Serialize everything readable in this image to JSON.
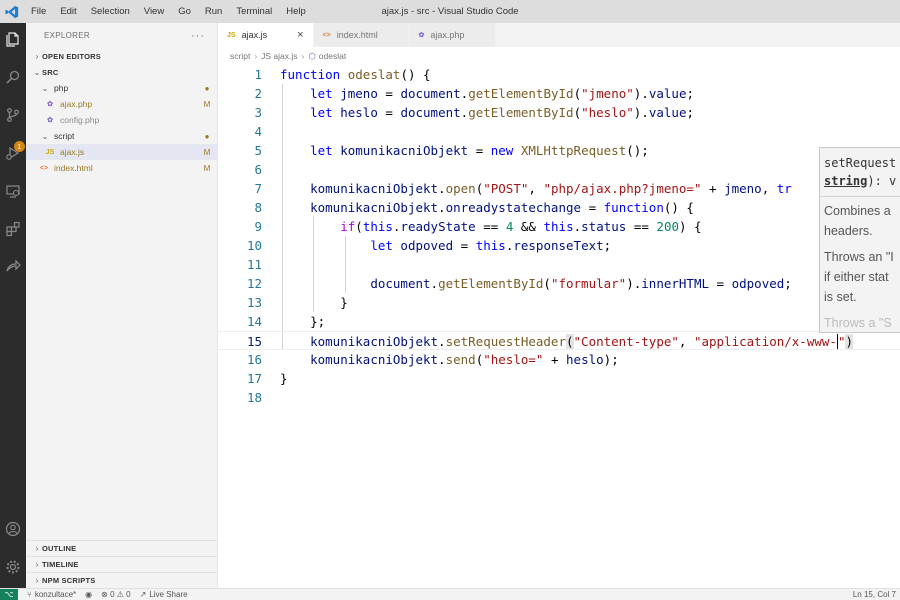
{
  "window": {
    "title": "ajax.js - src - Visual Studio Code",
    "menu": [
      "File",
      "Edit",
      "Selection",
      "View",
      "Go",
      "Run",
      "Terminal",
      "Help"
    ]
  },
  "activity": [
    "files-icon",
    "search-icon",
    "source-control-icon",
    "run-debug-icon",
    "remote-explorer-icon",
    "extensions-icon",
    "live-share-icon",
    "account-icon",
    "settings-gear-icon"
  ],
  "activity_badge": "1",
  "sidebar": {
    "header": "EXPLORER",
    "header_more": "···",
    "open_editors": "OPEN EDITORS",
    "root": "SRC",
    "tree": [
      {
        "label": "php",
        "kind": "folder",
        "status": "●"
      },
      {
        "label": "ajax.php",
        "kind": "php",
        "status": "M"
      },
      {
        "label": "config.php",
        "kind": "php",
        "status": ""
      },
      {
        "label": "script",
        "kind": "folder",
        "status": "●"
      },
      {
        "label": "ajax.js",
        "kind": "js",
        "status": "M"
      },
      {
        "label": "index.html",
        "kind": "html",
        "status": "M"
      }
    ],
    "bottom": [
      "OUTLINE",
      "TIMELINE",
      "NPM SCRIPTS"
    ]
  },
  "tabs": [
    {
      "label": "ajax.js",
      "icon": "JS",
      "active": true
    },
    {
      "label": "index.html",
      "icon": "<>",
      "active": false
    },
    {
      "label": "ajax.php",
      "icon": "php",
      "active": false
    }
  ],
  "tab_close": "×",
  "breadcrumb": [
    "script",
    "JS ajax.js",
    "odeslat"
  ],
  "editor": {
    "line_numbers": [
      "1",
      "2",
      "3",
      "4",
      "5",
      "6",
      "7",
      "8",
      "9",
      "10",
      "11",
      "12",
      "13",
      "14",
      "15",
      "16",
      "17",
      "18"
    ],
    "current_line": 15
  },
  "hover": {
    "sig_name": "setRequest",
    "sig_param": "string",
    "sig_rest": "): v",
    "para1": [
      "Combines a",
      "headers."
    ],
    "para2": [
      "Throws an \"I",
      "if either stat",
      "is set."
    ],
    "para3": "Throws a \"S"
  },
  "status": {
    "remote": "⌥",
    "branch": "konzultace*",
    "errors": "⊗ 0 ⚠ 0",
    "live_share": "Live Share",
    "position": "Ln 15, Col 7"
  }
}
